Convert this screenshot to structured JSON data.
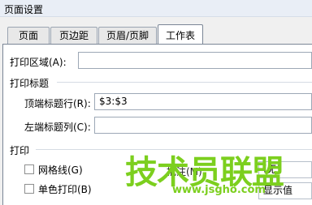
{
  "window": {
    "title": "页面设置"
  },
  "tabs": [
    {
      "label": "页面",
      "active": false
    },
    {
      "label": "页边距",
      "active": false
    },
    {
      "label": "页眉/页脚",
      "active": false
    },
    {
      "label": "工作表",
      "active": true
    }
  ],
  "print_area": {
    "label": "打印区域(A):",
    "value": ""
  },
  "print_titles": {
    "section_label": "打印标题",
    "top_rows": {
      "label": "顶端标题行(R):",
      "value": "$3:$3"
    },
    "left_cols": {
      "label": "左端标题列(C):",
      "value": ""
    }
  },
  "print": {
    "section_label": "打印",
    "gridlines": {
      "label": "网格线(G)",
      "checked": false
    },
    "mono": {
      "label": "单色打印(B)",
      "checked": false
    },
    "comments_label_partial": "批注(M)",
    "comments_value_partial": "(无)",
    "error_value_partial": "显示值"
  },
  "watermark": {
    "text": "技术员联盟",
    "url": "www.jsgho.com"
  }
}
